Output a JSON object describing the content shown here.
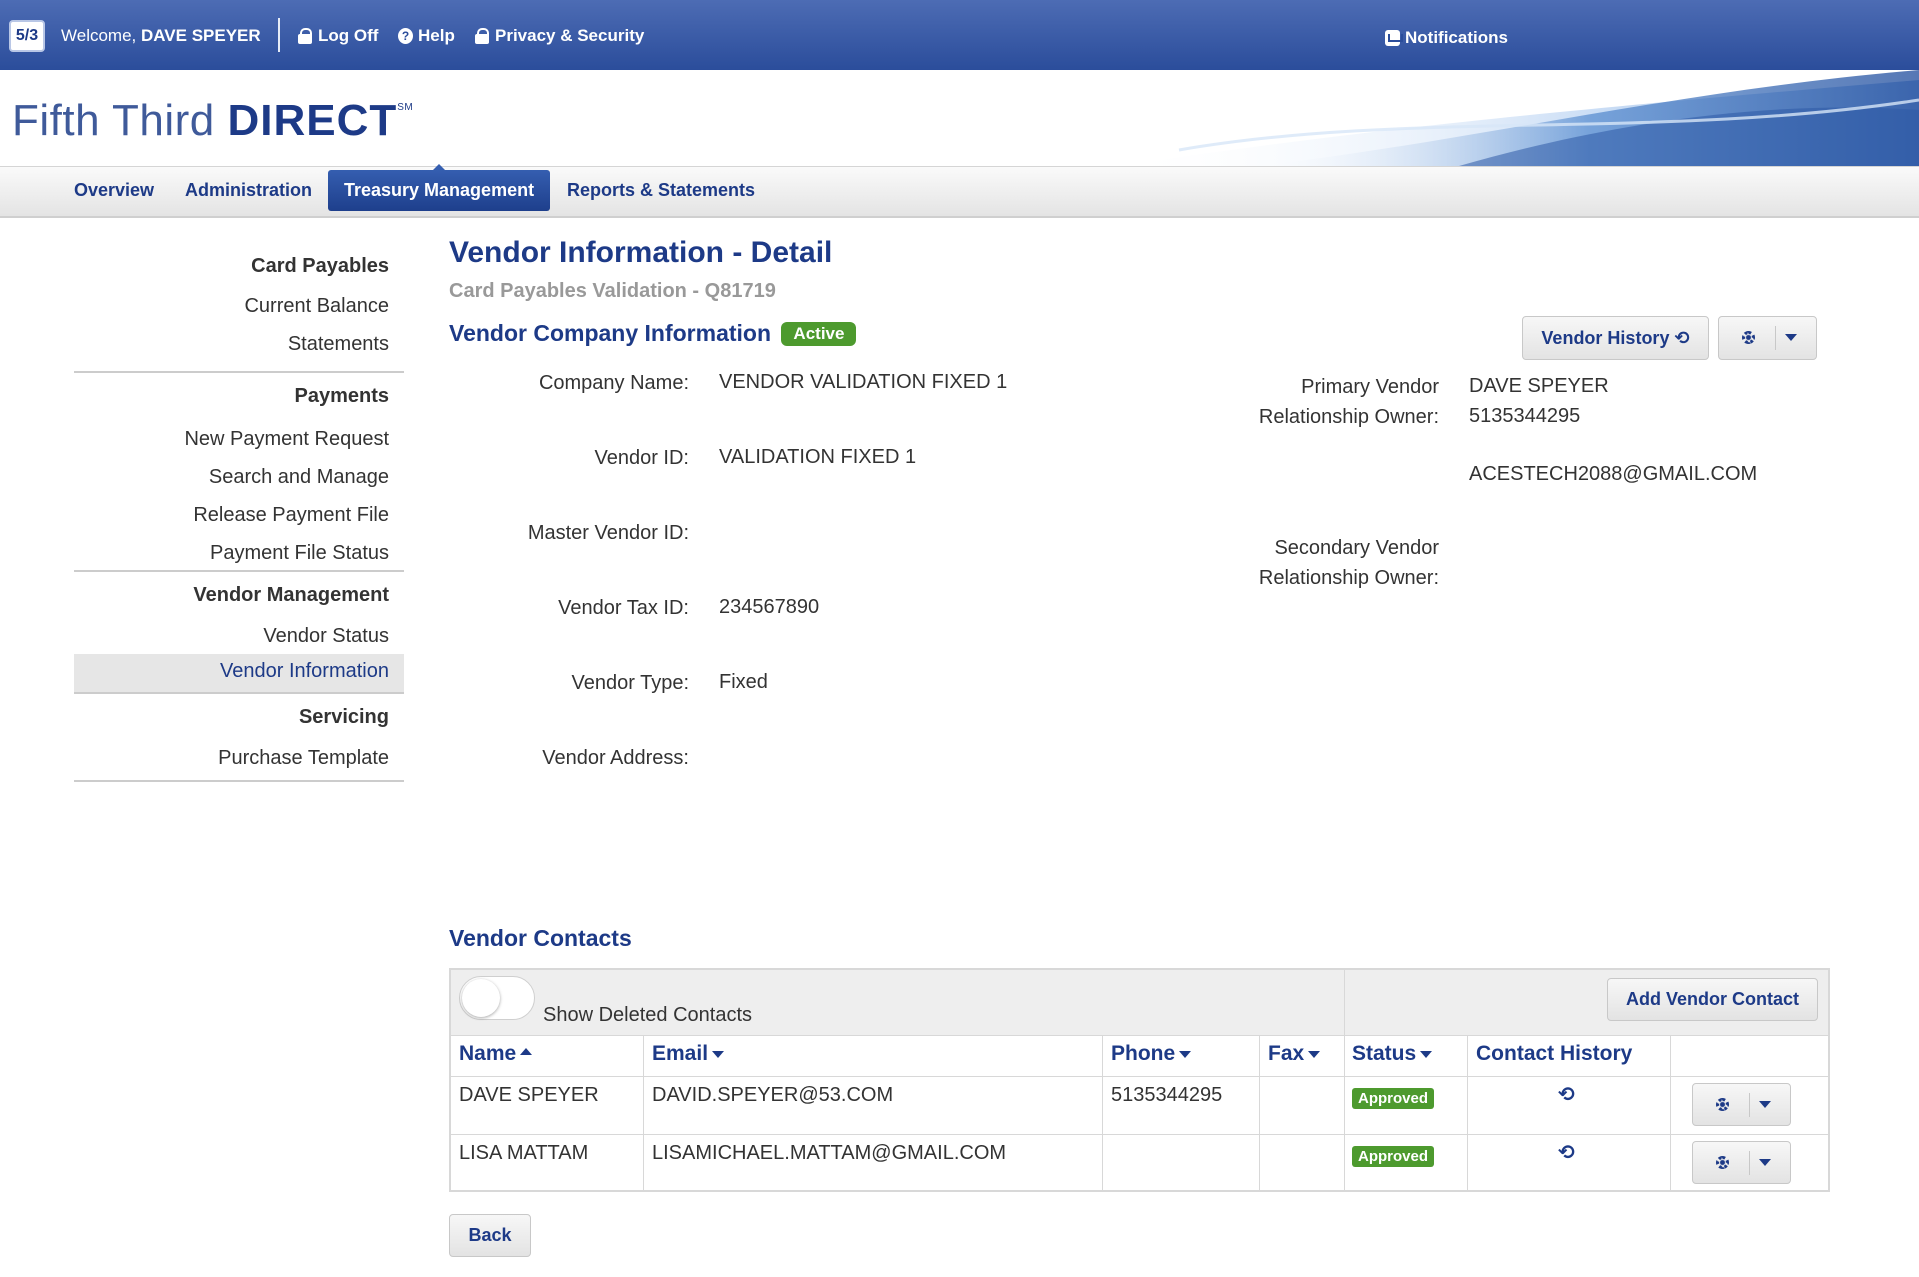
{
  "header": {
    "welcome_prefix": "Welcome,",
    "user_name": "DAVE SPEYER",
    "links": {
      "log_off": "Log Off",
      "help": "Help",
      "privacy": "Privacy & Security",
      "notifications": "Notifications"
    },
    "logo_text": "5/3"
  },
  "brand": {
    "name_light": "Fifth Third",
    "name_bold": "DIRECT",
    "mark": "SM"
  },
  "nav": {
    "tabs": [
      "Overview",
      "Administration",
      "Treasury Management",
      "Reports & Statements"
    ],
    "active": "Treasury Management"
  },
  "sidebar": {
    "sections": [
      {
        "title": "Card Payables",
        "items": [
          "Current Balance",
          "Statements"
        ]
      },
      {
        "title": "Payments",
        "items": [
          "New Payment Request",
          "Search and Manage",
          "Release Payment File",
          "Payment File Status"
        ]
      },
      {
        "title": "Vendor Management",
        "items": [
          "Vendor Status",
          "Vendor Information"
        ]
      },
      {
        "title": "Servicing",
        "items": [
          "Purchase Template"
        ]
      }
    ],
    "selected": "Vendor Information"
  },
  "page": {
    "title": "Vendor Information - Detail",
    "subtitle": "Card Payables Validation - Q81719",
    "company_section_title": "Vendor Company Information",
    "status_badge": "Active",
    "vendor_history_button": "Vendor History"
  },
  "company": {
    "company_name_label": "Company Name:",
    "company_name": "VENDOR VALIDATION FIXED 1",
    "vendor_id_label": "Vendor ID:",
    "vendor_id": "VALIDATION FIXED 1",
    "master_vendor_id_label": "Master Vendor ID:",
    "master_vendor_id": "",
    "tax_id_label": "Vendor Tax ID:",
    "tax_id": "234567890",
    "type_label": "Vendor Type:",
    "type": "Fixed",
    "address_label": "Vendor Address:",
    "address": "",
    "primary_owner_label_1": "Primary Vendor",
    "primary_owner_label_2": "Relationship Owner:",
    "primary_owner_name": "DAVE SPEYER",
    "primary_owner_phone": "5135344295",
    "primary_owner_email": "ACESTECH2088@GMAIL.COM",
    "secondary_owner_label_1": "Secondary Vendor",
    "secondary_owner_label_2": "Relationship Owner:"
  },
  "contacts": {
    "title": "Vendor Contacts",
    "show_deleted_label": "Show Deleted Contacts",
    "add_button": "Add Vendor Contact",
    "columns": [
      "Name",
      "Email",
      "Phone",
      "Fax",
      "Status",
      "Contact History"
    ],
    "rows": [
      {
        "name": "DAVE SPEYER",
        "email": "DAVID.SPEYER@53.COM",
        "phone": "5135344295",
        "fax": "",
        "status": "Approved"
      },
      {
        "name": "LISA MATTAM",
        "email": "LISAMICHAEL.MATTAM@GMAIL.COM",
        "phone": "",
        "fax": "",
        "status": "Approved"
      }
    ]
  },
  "footer": {
    "back_button": "Back"
  },
  "colors": {
    "brand_blue": "#1d3a87",
    "active_green": "#4d9a2e"
  }
}
